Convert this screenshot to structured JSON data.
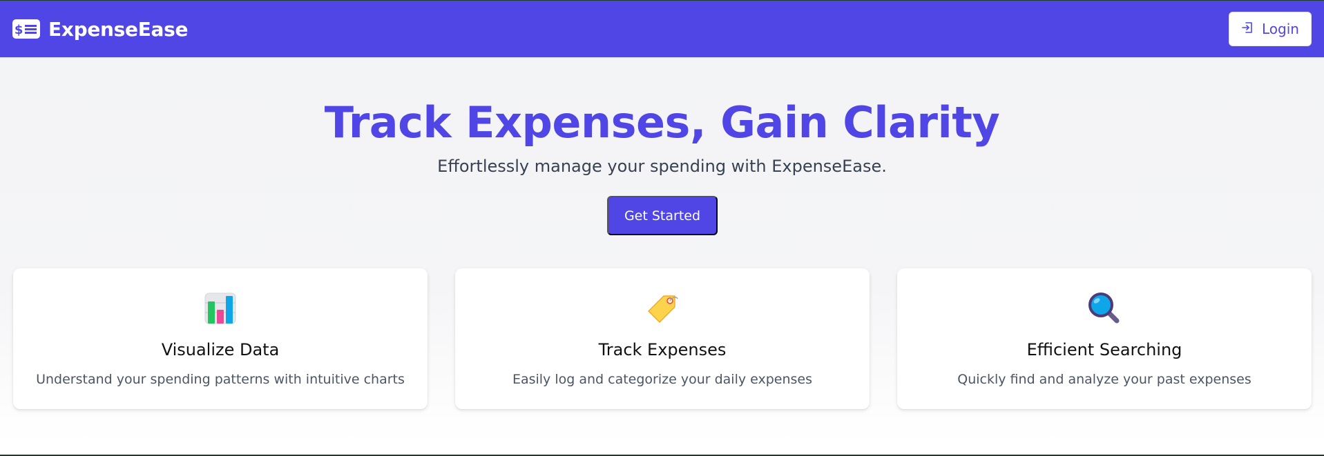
{
  "brand": {
    "name": "ExpenseEase",
    "icon": "money-bill-icon"
  },
  "nav": {
    "login_label": "Login",
    "login_icon": "sign-in-icon"
  },
  "hero": {
    "title": "Track Expenses, Gain Clarity",
    "subtitle": "Effortlessly manage your spending with ExpenseEase.",
    "cta_label": "Get Started"
  },
  "features": [
    {
      "icon": "bar-chart-icon",
      "title": "Visualize Data",
      "description": "Understand your spending patterns with intuitive charts"
    },
    {
      "icon": "price-tag-icon",
      "title": "Track Expenses",
      "description": "Easily log and categorize your daily expenses"
    },
    {
      "icon": "magnifying-glass-icon",
      "title": "Efficient Searching",
      "description": "Quickly find and analyze your past expenses"
    }
  ],
  "colors": {
    "primary": "#4f46e5",
    "background": "#f3f4f6",
    "card": "#ffffff",
    "text_muted": "#4b5563"
  }
}
